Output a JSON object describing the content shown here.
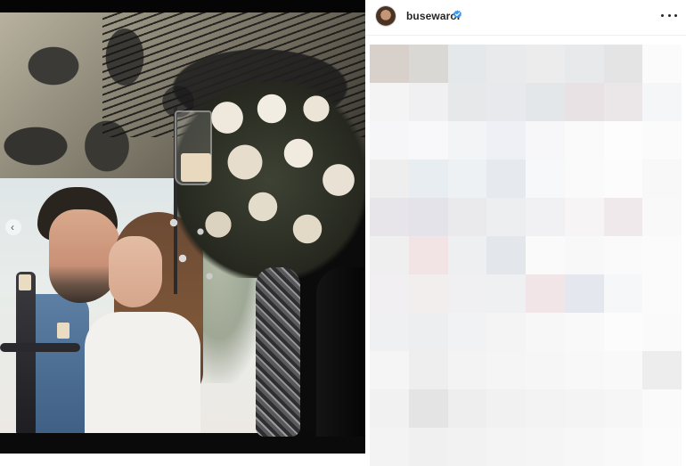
{
  "post": {
    "author": {
      "username": "busewarol",
      "verified": true
    },
    "media": {
      "carousel_prev_glyph": "‹",
      "carousel_prev_icon": "chevron-left-icon"
    },
    "header": {
      "more_icon": "more-horizontal-icon",
      "verified_icon": "verified-badge-icon"
    },
    "pixelated_area": {
      "rows": 11,
      "columns": 8,
      "colors": [
        [
          "#d8d0cb",
          "#d9d8d5",
          "#e4e8eb",
          "#e8eaeb",
          "#ececec",
          "#e8e9ea",
          "#e4e4e4",
          "#fbfbfb"
        ],
        [
          "#f4f4f4",
          "#f0f0f2",
          "#e6e8ea",
          "#e7e9ec",
          "#e4e7ea",
          "#e8e2e4",
          "#ebe7e9",
          "#f5f6f8"
        ],
        [
          "#f6f6f8",
          "#f8f8fa",
          "#f3f4f6",
          "#eef0f5",
          "#f7f7f9",
          "#fafafb",
          "#fdfdfd",
          "#fbfbfb"
        ],
        [
          "#eeeeef",
          "#e8edf1",
          "#eef1f4",
          "#e6eaef",
          "#f7f8f9",
          "#fafafa",
          "#fcfcfc",
          "#f8f8f8"
        ],
        [
          "#e7e5ea",
          "#e4e3e9",
          "#eaeaec",
          "#eceef0",
          "#f1f1f3",
          "#f6f4f5",
          "#efe9ec",
          "#f9f9f9"
        ],
        [
          "#efeff0",
          "#f2e4e4",
          "#eeeff1",
          "#e3e6ea",
          "#fafafa",
          "#f8f8f8",
          "#fafafa",
          "#fbfbfb"
        ],
        [
          "#f1eff1",
          "#f2eeee",
          "#f0f0f2",
          "#eff0f2",
          "#f2e5e8",
          "#e5e7ef",
          "#f6f7f8",
          "#fbfbfb"
        ],
        [
          "#eff0f1",
          "#eceef0",
          "#f1f2f3",
          "#f4f4f5",
          "#f7f7f8",
          "#f9f9fa",
          "#fcfcfc",
          "#fafafa"
        ],
        [
          "#f5f5f5",
          "#eeeeef",
          "#f3f3f4",
          "#f5f5f6",
          "#f6f6f7",
          "#f8f8f8",
          "#f9f9f9",
          "#ededed"
        ],
        [
          "#f1f1f1",
          "#e4e4e5",
          "#eeeeee",
          "#f1f1f2",
          "#f3f3f4",
          "#f4f4f4",
          "#f6f6f6",
          "#fafafa"
        ],
        [
          "#f3f3f3",
          "#f0f0f0",
          "#f2f2f3",
          "#f4f4f4",
          "#f5f5f5",
          "#f7f7f7",
          "#f9f9f9",
          "#fbfbfb"
        ]
      ]
    }
  }
}
